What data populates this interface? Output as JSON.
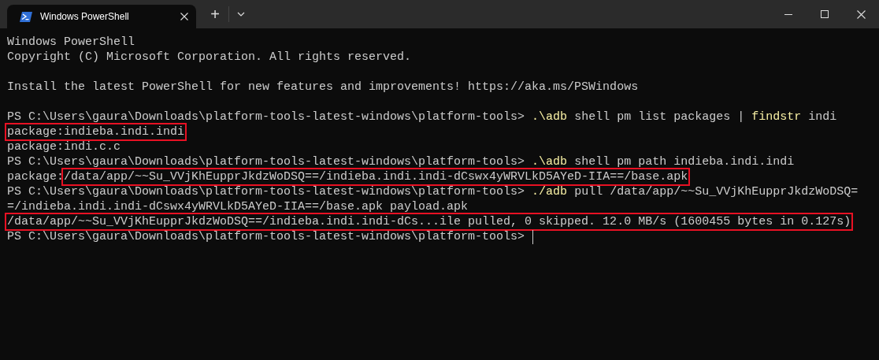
{
  "tabs": [
    {
      "title": "Windows PowerShell",
      "selected": true
    }
  ],
  "new_tab": "+",
  "console_lines": [
    [
      {
        "text": "Windows PowerShell",
        "kind": "output"
      }
    ],
    [
      {
        "text": "Copyright (C) Microsoft Corporation. All rights reserved.",
        "kind": "output"
      }
    ],
    [
      {
        "kind": "blank"
      }
    ],
    [
      {
        "text": "Install the latest PowerShell for new features and improvements! https://aka.ms/PSWindows",
        "kind": "output"
      }
    ],
    [
      {
        "kind": "blank"
      }
    ],
    [
      {
        "text": "PS C:\\Users\\gaura\\Downloads\\platform-tools-latest-windows\\platform-tools>",
        "kind": "prompt"
      },
      {
        "text": ".\\adb",
        "kind": "command"
      },
      {
        "text": "shell pm list packages |",
        "kind": "output"
      },
      {
        "text": "findstr",
        "kind": "command"
      },
      {
        "text": "indi",
        "kind": "output"
      }
    ],
    [
      {
        "text": "package:indieba.indi.indi",
        "kind": "output",
        "boxed": true
      }
    ],
    [
      {
        "text": "package:indi.c.c",
        "kind": "output"
      }
    ],
    [
      {
        "text": "PS C:\\Users\\gaura\\Downloads\\platform-tools-latest-windows\\platform-tools>",
        "kind": "prompt"
      },
      {
        "text": ".\\adb",
        "kind": "command"
      },
      {
        "text": "shell pm path indieba.indi.indi",
        "kind": "output"
      }
    ],
    [
      {
        "text": "package:",
        "kind": "output"
      },
      {
        "text": "/data/app/~~Su_VVjKhEupprJkdzWoDSQ==/indieba.indi.indi-dCswx4yWRVLkD5AYeD-IIA==/base.apk",
        "kind": "output",
        "boxed": true
      }
    ],
    [
      {
        "text": "PS C:\\Users\\gaura\\Downloads\\platform-tools-latest-windows\\platform-tools>",
        "kind": "prompt"
      },
      {
        "text": "./adb",
        "kind": "command"
      },
      {
        "text": "pull /data/app/~~Su_VVjKhEupprJkdzWoDSQ=",
        "kind": "output"
      }
    ],
    [
      {
        "text": "=/indieba.indi.indi-dCswx4yWRVLkD5AYeD-IIA==/base.apk payload.apk",
        "kind": "output"
      }
    ],
    [
      {
        "text": "/data/app/~~Su_VVjKhEupprJkdzWoDSQ==/indieba.indi.indi-dCs...ile pulled, 0 skipped. 12.0 MB/s (1600455 bytes in 0.127s)",
        "kind": "output",
        "boxed": true
      }
    ],
    [
      {
        "text": "PS C:\\Users\\gaura\\Downloads\\platform-tools-latest-windows\\platform-tools>",
        "kind": "prompt",
        "cursor": true
      }
    ]
  ]
}
